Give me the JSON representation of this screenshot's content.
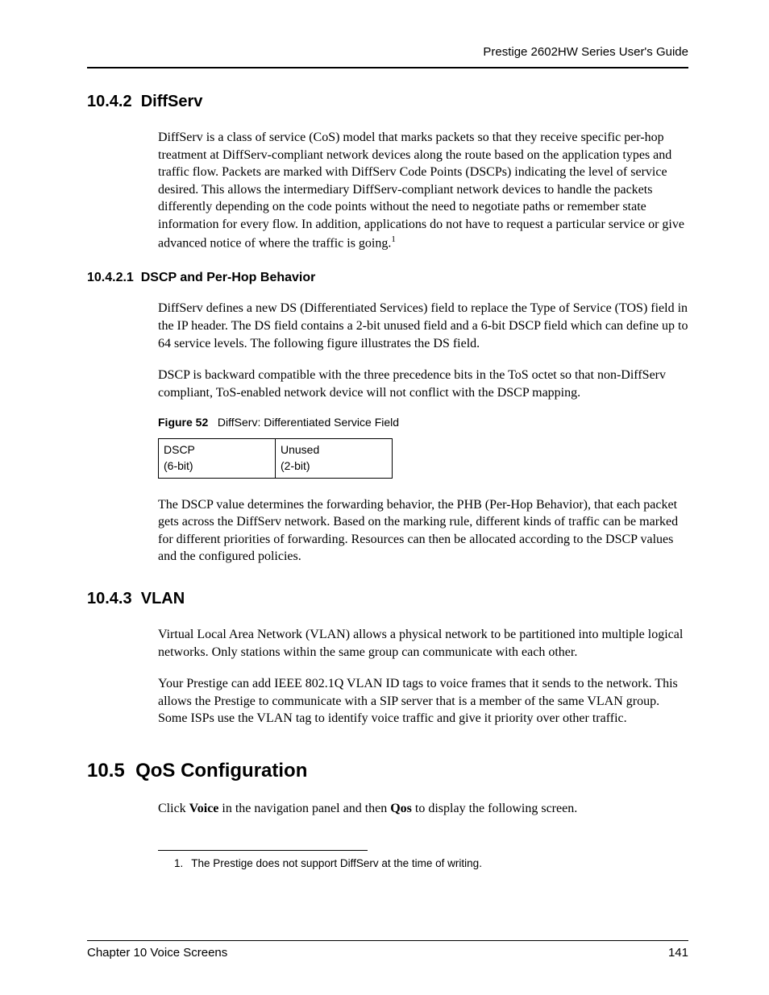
{
  "header": {
    "guide_title": "Prestige 2602HW Series User's Guide"
  },
  "sections": {
    "s1": {
      "num": "10.4.2",
      "title": "DiffServ",
      "para1_a": "DiffServ is a class of service (CoS) model that marks packets so that they receive specific per-hop treatment at DiffServ-compliant network devices along the route based on the application types and traffic flow. Packets are marked with DiffServ Code Points (DSCPs) indicating the level of service desired. This allows the intermediary DiffServ-compliant network devices to handle the packets differently depending on the code points without the need to negotiate paths or remember state information for every flow. In addition, applications do not have to request a particular service or give advanced notice of where the traffic is going.",
      "fn_marker": "1"
    },
    "s1_1": {
      "num": "10.4.2.1",
      "title": "DSCP and Per-Hop Behavior",
      "para1": "DiffServ defines a new DS (Differentiated Services) field to replace the Type of Service (TOS) field in the IP header. The DS field contains a 2-bit unused field and a 6-bit DSCP field which can define up to 64 service levels. The following figure illustrates the DS field.",
      "para2": "DSCP is backward compatible with the three precedence bits in the ToS octet so that non-DiffServ compliant, ToS-enabled network device will not conflict with the DSCP mapping.",
      "para3": "The DSCP value determines the forwarding behavior, the PHB (Per-Hop Behavior), that each packet gets across the DiffServ network.  Based on the marking rule, different kinds of traffic can be marked for different priorities of forwarding. Resources can then be allocated according to the DSCP values and the configured policies."
    },
    "figure": {
      "label": "Figure 52",
      "caption": "DiffServ: Differentiated Service Field",
      "cell1_l1": "DSCP",
      "cell1_l2": "(6-bit)",
      "cell2_l1": "Unused",
      "cell2_l2": "(2-bit)"
    },
    "s2": {
      "num": "10.4.3",
      "title": "VLAN",
      "para1": "Virtual Local Area Network (VLAN) allows a physical network to be partitioned into multiple logical networks. Only stations within the same group can communicate with each other.",
      "para2": "Your Prestige can add IEEE 802.1Q VLAN ID tags to voice frames that it sends to the network. This allows the Prestige to communicate with a SIP server that is a member of the same VLAN group. Some ISPs use the VLAN tag to identify voice traffic and give it priority over other traffic."
    },
    "s3": {
      "num": "10.5",
      "title": "QoS Configuration",
      "para1_pre": "Click ",
      "para1_b1": "Voice",
      "para1_mid": " in the navigation panel and then ",
      "para1_b2": "Qos",
      "para1_post": " to display the following screen."
    }
  },
  "footnote": {
    "num": "1.",
    "text": "The Prestige does not support DiffServ at the time of writing."
  },
  "footer": {
    "chapter": "Chapter 10 Voice Screens",
    "page": "141"
  }
}
